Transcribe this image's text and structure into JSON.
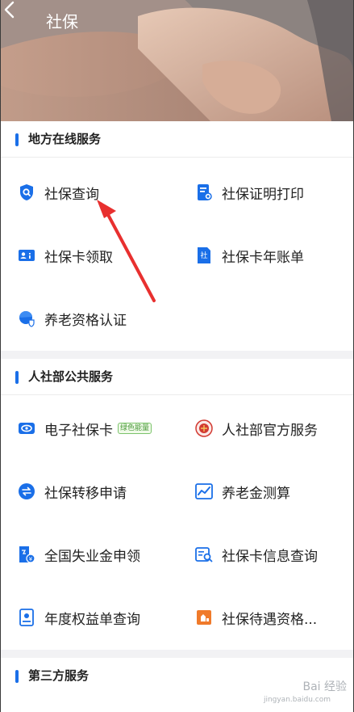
{
  "header": {
    "title": "社保"
  },
  "sections": [
    {
      "title": "地方在线服务",
      "items": [
        {
          "label": "社保查询",
          "icon": "shield-search-icon"
        },
        {
          "label": "社保证明打印",
          "icon": "certificate-print-icon"
        },
        {
          "label": "社保卡领取",
          "icon": "id-card-icon"
        },
        {
          "label": "社保卡年账单",
          "icon": "annual-bill-icon"
        },
        {
          "label": "养老资格认证",
          "icon": "pension-certify-icon"
        }
      ]
    },
    {
      "title": "人社部公共服务",
      "items": [
        {
          "label": "电子社保卡",
          "icon": "e-card-icon",
          "badge": "绿色能量"
        },
        {
          "label": "人社部官方服务",
          "icon": "official-emblem-icon"
        },
        {
          "label": "社保转移申请",
          "icon": "transfer-icon"
        },
        {
          "label": "养老金测算",
          "icon": "chart-icon"
        },
        {
          "label": "全国失业金申领",
          "icon": "unemployment-icon"
        },
        {
          "label": "社保卡信息查询",
          "icon": "card-info-search-icon"
        },
        {
          "label": "年度权益单查询",
          "icon": "rights-statement-icon"
        },
        {
          "label": "社保待遇资格...",
          "icon": "benefit-qualification-icon"
        }
      ]
    },
    {
      "title": "第三方服务",
      "items": []
    }
  ],
  "watermark": {
    "main": "Bai 经验",
    "sub": "jingyan.baidu.com"
  },
  "colors": {
    "accent": "#1a6fe8",
    "badge_green": "#4a9a3b",
    "annotation_red": "#e8302f"
  }
}
